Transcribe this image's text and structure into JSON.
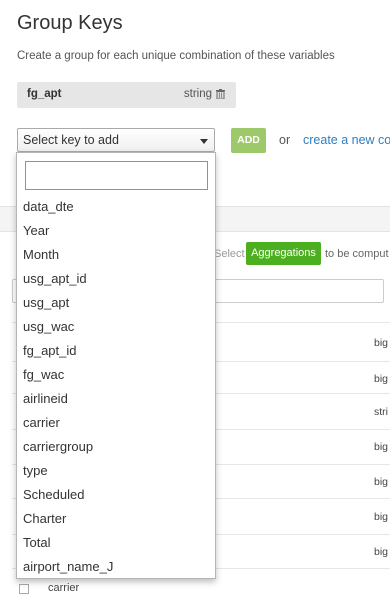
{
  "header": {
    "title": "Group Keys",
    "subtitle": "Create a group for each unique combination of these variables"
  },
  "group_key": {
    "name": "fg_apt",
    "type": "string"
  },
  "controls": {
    "select_label": "Select key to add",
    "add_label": "ADD",
    "or_text": "or",
    "create_link": "create a new co"
  },
  "aggregations": {
    "select_text": "Select",
    "button_label": "Aggregations",
    "suffix_text": "to be comput"
  },
  "row_types": [
    "big",
    "big",
    "stri",
    "big",
    "big",
    "big",
    "big"
  ],
  "bottom_row_text": "carrier",
  "dropdown": {
    "search_value": "",
    "items": [
      "data_dte",
      "Year",
      "Month",
      "usg_apt_id",
      "usg_apt",
      "usg_wac",
      "fg_apt_id",
      "fg_wac",
      "airlineid",
      "carrier",
      "carriergroup",
      "type",
      "Scheduled",
      "Charter",
      "Total",
      "airport_name_J"
    ]
  }
}
